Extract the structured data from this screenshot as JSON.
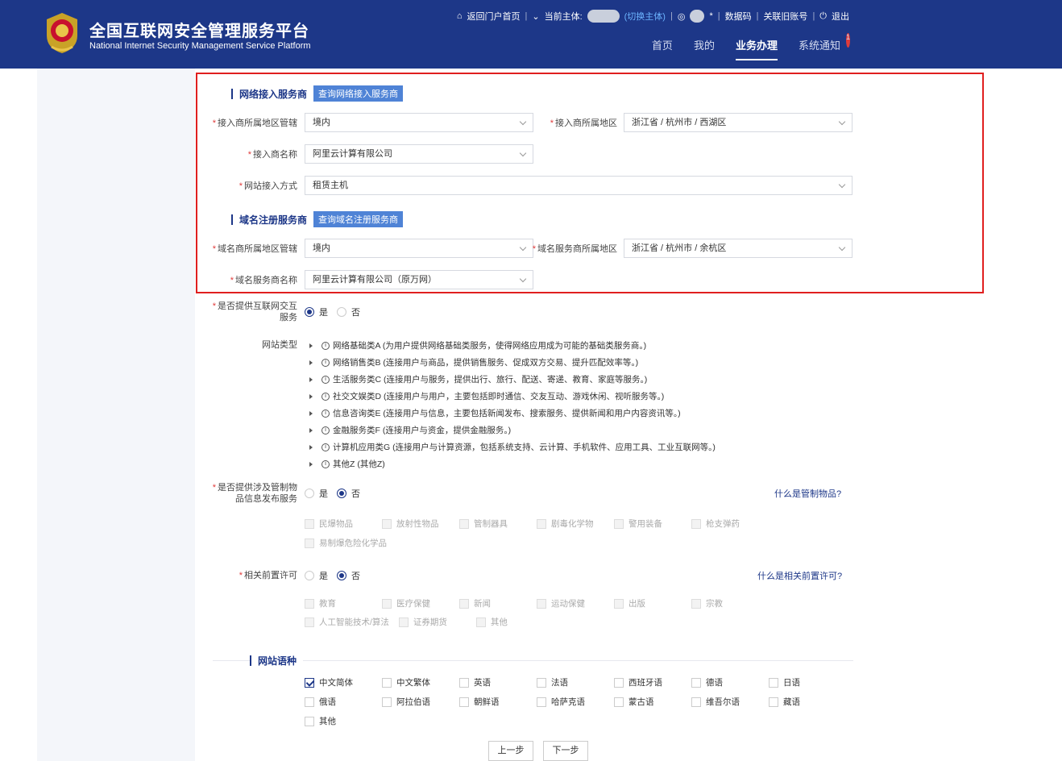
{
  "header": {
    "title_cn": "全国互联网安全管理服务平台",
    "title_en": "National Internet Security Management Service Platform",
    "portal": "返回门户首页",
    "subject_label": "当前主体:",
    "switch_subject": "(切换主体)",
    "user_suffix": "*",
    "data_code": "数据码",
    "link_old": "关联旧账号",
    "logout": "退出",
    "nav": [
      "首页",
      "我的",
      "业务办理",
      "系统通知"
    ],
    "notify_count": "1"
  },
  "access": {
    "section": "网络接入服务商",
    "query_btn": "查询网络接入服务商",
    "region_mgmt_label": "接入商所属地区管辖",
    "region_mgmt_value": "境内",
    "region_label": "接入商所属地区",
    "region_value": "浙江省 / 杭州市 / 西湖区",
    "name_label": "接入商名称",
    "name_value": "阿里云计算有限公司",
    "method_label": "网站接入方式",
    "method_value": "租赁主机"
  },
  "domain": {
    "section": "域名注册服务商",
    "query_btn": "查询域名注册服务商",
    "region_mgmt_label": "域名商所属地区管辖",
    "region_mgmt_value": "境内",
    "region_label": "域名服务商所属地区",
    "region_value": "浙江省 / 杭州市 / 余杭区",
    "name_label": "域名服务商名称",
    "name_value": "阿里云计算有限公司（原万网）"
  },
  "interactive": {
    "label": "是否提供互联网交互服务",
    "yes": "是",
    "no": "否"
  },
  "site_type": {
    "label": "网站类型",
    "items": [
      "网络基础类A (为用户提供网络基础类服务，使得网络应用成为可能的基础类服务商。)",
      "网络销售类B (连接用户与商品，提供销售服务、促成双方交易、提升匹配效率等。)",
      "生活服务类C (连接用户与服务，提供出行、旅行、配送、寄递、教育、家庭等服务。)",
      "社交文娱类D (连接用户与用户，主要包括即时通信、交友互动、游戏休闲、视听服务等。)",
      "信息咨询类E (连接用户与信息，主要包括新闻发布、搜索服务、提供新闻和用户内容资讯等。)",
      "金融服务类F (连接用户与资金，提供金融服务。)",
      "计算机应用类G (连接用户与计算资源，包括系统支持、云计算、手机软件、应用工具、工业互联网等。)",
      "其他Z (其他Z)"
    ]
  },
  "controlled": {
    "label": "是否提供涉及管制物品信息发布服务",
    "yes": "是",
    "no": "否",
    "help": "什么是管制物品?",
    "items": [
      "民爆物品",
      "放射性物品",
      "管制器具",
      "剧毒化学物",
      "警用装备",
      "枪支弹药",
      "易制爆危险化学品"
    ]
  },
  "permit": {
    "label": "相关前置许可",
    "yes": "是",
    "no": "否",
    "help": "什么是相关前置许可?",
    "items": [
      "教育",
      "医疗保健",
      "新闻",
      "运动保健",
      "出版",
      "宗教",
      "人工智能技术/算法",
      "证券期货",
      "其他"
    ]
  },
  "language": {
    "section": "网站语种",
    "items": [
      "中文简体",
      "中文繁体",
      "英语",
      "法语",
      "西班牙语",
      "德语",
      "日语",
      "俄语",
      "阿拉伯语",
      "朝鲜语",
      "哈萨克语",
      "蒙古语",
      "维吾尔语",
      "藏语",
      "其他"
    ],
    "checked": [
      "中文简体"
    ]
  },
  "footer": {
    "prev": "上一步",
    "next": "下一步"
  }
}
